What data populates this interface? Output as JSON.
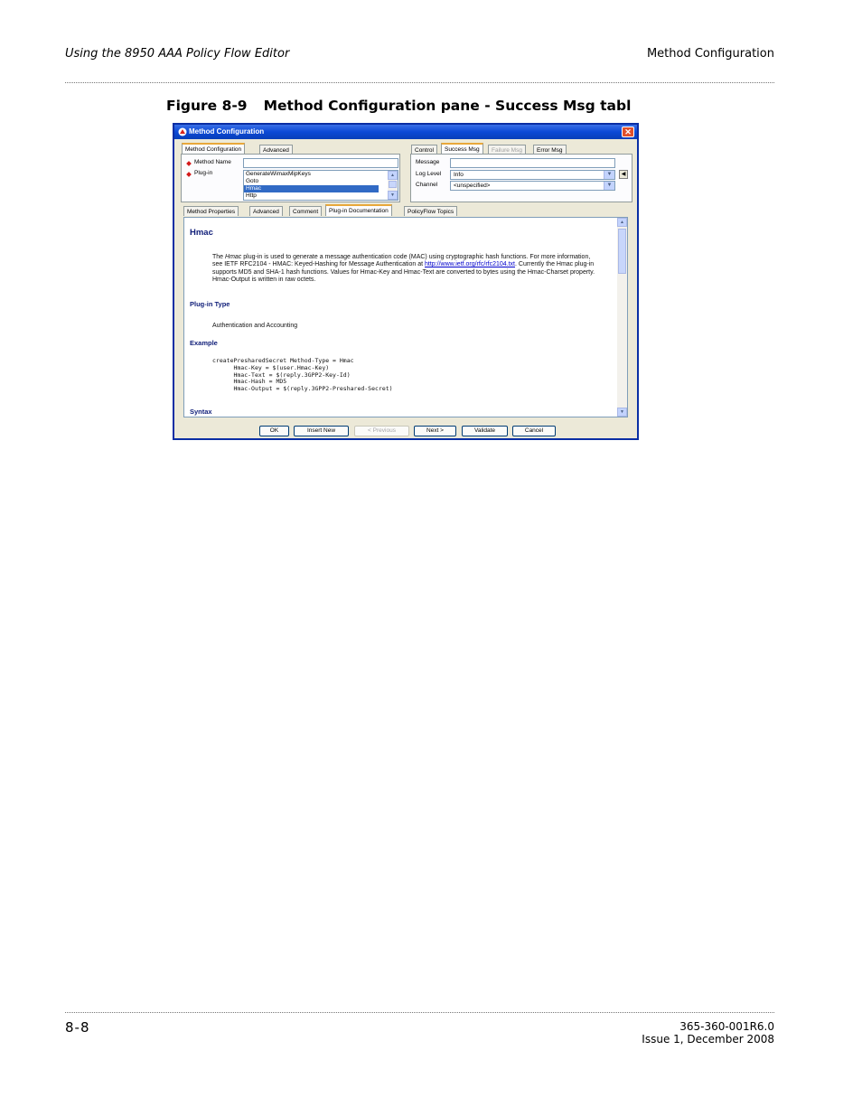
{
  "page": {
    "header_left": "Using the 8950 AAA Policy Flow Editor",
    "header_right": "Method Configuration",
    "figure_number": "Figure 8-9",
    "figure_title": "Method Configuration pane - Success Msg tabl",
    "footer_page": "8-8",
    "footer_doc": "365-360-001R6.0",
    "footer_issue": "Issue 1, December 2008"
  },
  "window": {
    "title": "Method Configuration",
    "close_glyph": "✕",
    "left_tabs": [
      "Method Configuration",
      "Advanced"
    ],
    "method_name_label": "Method Name",
    "method_name_value": "",
    "plugin_label": "Plug-in",
    "plugin_items": [
      "GenerateWimaxMipKeys",
      "Goto",
      "Hmac",
      "Http"
    ],
    "plugin_selected": "Hmac",
    "right_tabs": [
      "Control",
      "Success Msg",
      "Failure Msg",
      "Error Msg"
    ],
    "right_tab_active": "Success Msg",
    "right_tab_disabled": "Failure Msg",
    "message_label": "Message",
    "message_value": "",
    "log_level_label": "Log Level",
    "log_level_value": "Info",
    "channel_label": "Channel",
    "channel_value": "<unspecified>",
    "lower_tabs": [
      "Method Properties",
      "Advanced",
      "Comment",
      "Plug-in Documentation",
      "PolicyFlow Topics"
    ],
    "lower_tab_active": "Plug-in Documentation",
    "doc": {
      "heading": "Hmac",
      "intro_pre": "The",
      "intro_em": "Hmac",
      "intro_1": "plug-in is used to generate a message authentication code (MAC) using cryptographic hash functions. For more information, see IETF RFC2104 - HMAC: Keyed-Hashing for Message Authentication at",
      "intro_link": "http://www.ietf.org/rfc/rfc2104.txt",
      "intro_2": ". Currently the Hmac plug-in supports MD5 and SHA-1 hash functions. Values for Hmac-Key and Hmac-Text are converted to bytes using the Hmac-Charset property. Hmac-Output is written in raw octets.",
      "plugin_type_heading": "Plug-in Type",
      "plugin_type_text": "Authentication and Accounting",
      "example_heading": "Example",
      "example_code": [
        "createPresharedSecret Method-Type = Hmac",
        "      Hmac-Key = $(user.Hmac-Key)",
        "      Hmac-Text = $(reply.3GPP2-Key-Id)",
        "      Hmac-Hash = MD5",
        "      Hmac-Output = $(reply.3GPP2-Preshared-Secret)"
      ],
      "syntax_heading": "Syntax"
    },
    "buttons": [
      "OK",
      "Insert New",
      "< Previous",
      "Next >",
      "Validate",
      "Cancel"
    ],
    "disabled_button": "< Previous"
  }
}
